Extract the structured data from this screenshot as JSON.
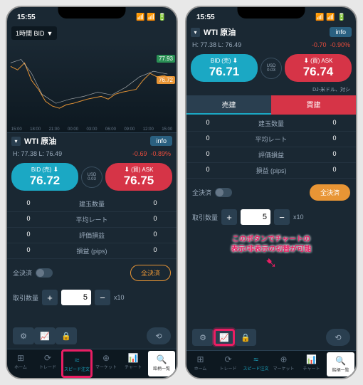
{
  "status": {
    "time": "15:55"
  },
  "timeframe": "1時間 BID",
  "ticker": "WTI 原油",
  "info_btn": "info",
  "hl": {
    "h": "H: 77.38",
    "l": "L: 76.49",
    "chg": "-0.69",
    "pct": "-0.89%"
  },
  "hl2": {
    "h": "H: 77.38",
    "l": "L: 76.49",
    "chg": "-0.70",
    "pct": "-0.90%"
  },
  "chart": {
    "times": [
      "15:00",
      "18:00",
      "21:00",
      "00:00",
      "03:00",
      "06:00",
      "09:00",
      "12:00",
      "15:00"
    ],
    "tag_hi": "77.93",
    "tag_lo": "76.72"
  },
  "bid": {
    "label": "BID",
    "side": "(売)",
    "price1": "76.72",
    "price2": "76.71"
  },
  "ask": {
    "label": "ASK",
    "side": "(買)",
    "price1": "76.75",
    "price2": "76.74"
  },
  "usd": {
    "label": "USD",
    "val": "0.03"
  },
  "pair_info": "DJ-米ドル、対シ",
  "tabs": {
    "sell": "売建",
    "buy": "買建"
  },
  "positions": [
    {
      "l": "0",
      "name": "建玉数量",
      "r": "0"
    },
    {
      "l": "0",
      "name": "平均レート",
      "r": "0"
    },
    {
      "l": "0",
      "name": "評価損益",
      "r": "0"
    },
    {
      "l": "0",
      "name": "損益 (pips)",
      "r": "0"
    }
  ],
  "settle": {
    "label": "全決済",
    "btn": "全決済"
  },
  "qty": {
    "label": "取引数量",
    "val": "5",
    "mult": "x10"
  },
  "annotation": {
    "l1": "このボタンでチャートの",
    "l2": "表示/非表示の切替が可能"
  },
  "tabbar": [
    "ホーム",
    "トレード",
    "スピード注文",
    "マーケット",
    "チャート",
    "銘柄一覧"
  ]
}
